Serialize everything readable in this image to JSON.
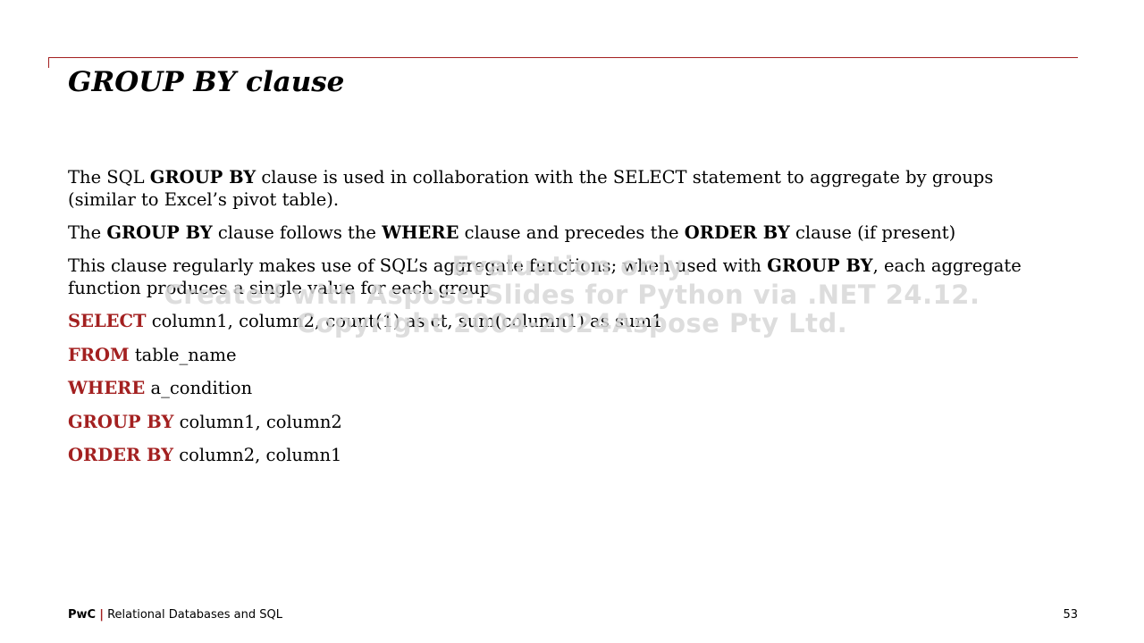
{
  "slide": {
    "title": "GROUP BY clause",
    "accent_color": "#a32020"
  },
  "paragraphs": [
    {
      "t1": "The SQL ",
      "b1": "GROUP BY",
      "t2": " clause is used in collaboration with the SELECT statement to aggregate by groups (similar to Excel’s pivot table)."
    },
    {
      "t1": "The ",
      "b1": "GROUP BY",
      "t2": " clause follows the ",
      "b2": "WHERE",
      "t3": " clause and precedes the ",
      "b3": "ORDER BY",
      "t4": " clause (if present)"
    },
    {
      "t1": "This clause regularly makes use of SQL’s aggregate functions; when used with ",
      "b1": "GROUP BY",
      "t2": ", each aggregate function produces a single value for each group"
    }
  ],
  "sql": [
    {
      "keyword": "SELECT",
      "rest": " column1, column2, count(1) as ct, sum(column1) as sum1"
    },
    {
      "keyword": "FROM",
      "rest": " table_name"
    },
    {
      "keyword": "WHERE",
      "rest": " a_condition"
    },
    {
      "keyword": "GROUP BY",
      "rest": " column1, column2"
    },
    {
      "keyword": "ORDER BY",
      "rest": " column2, column1"
    }
  ],
  "watermark": {
    "line1": "Evaluation only.",
    "line2": "Created with Aspose.Slides for Python via .NET 24.12.",
    "line3": "Copyright 2004-2024Aspose Pty Ltd."
  },
  "footer": {
    "brand": "PwC",
    "separator": "|",
    "text": "Relational Databases and SQL",
    "page_number": "53"
  }
}
